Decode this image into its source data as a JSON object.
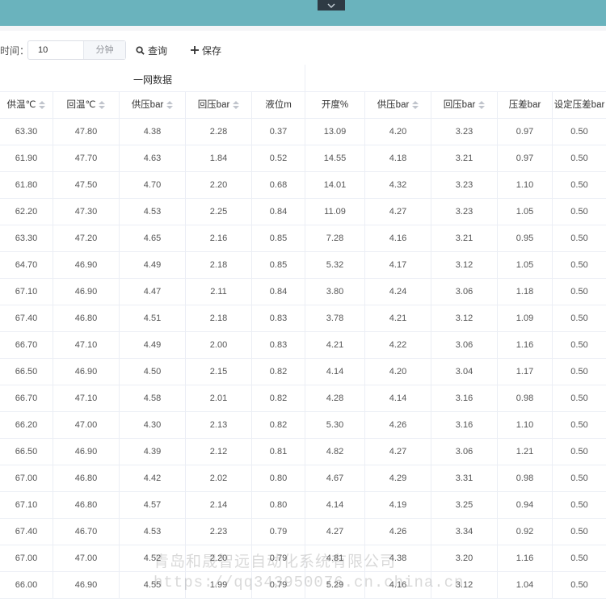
{
  "toolbar": {
    "time_label": "时间：",
    "interval_value": "10",
    "interval_unit": "分钟",
    "query_label": "查询",
    "save_label": "保存"
  },
  "group_title": "一网数据",
  "columns": [
    "供温℃",
    "回温℃",
    "供压bar",
    "回压bar",
    "液位m",
    "开度%",
    "供压bar",
    "回压bar",
    "压差bar",
    "设定压差bar"
  ],
  "rows": [
    [
      "63.30",
      "47.80",
      "4.38",
      "2.28",
      "0.37",
      "13.09",
      "4.20",
      "3.23",
      "0.97",
      "0.50"
    ],
    [
      "61.90",
      "47.70",
      "4.63",
      "1.84",
      "0.52",
      "14.55",
      "4.18",
      "3.21",
      "0.97",
      "0.50"
    ],
    [
      "61.80",
      "47.50",
      "4.70",
      "2.20",
      "0.68",
      "14.01",
      "4.32",
      "3.23",
      "1.10",
      "0.50"
    ],
    [
      "62.20",
      "47.30",
      "4.53",
      "2.25",
      "0.84",
      "11.09",
      "4.27",
      "3.23",
      "1.05",
      "0.50"
    ],
    [
      "63.30",
      "47.20",
      "4.65",
      "2.16",
      "0.85",
      "7.28",
      "4.16",
      "3.21",
      "0.95",
      "0.50"
    ],
    [
      "64.70",
      "46.90",
      "4.49",
      "2.18",
      "0.85",
      "5.32",
      "4.17",
      "3.12",
      "1.05",
      "0.50"
    ],
    [
      "67.10",
      "46.90",
      "4.47",
      "2.11",
      "0.84",
      "3.80",
      "4.24",
      "3.06",
      "1.18",
      "0.50"
    ],
    [
      "67.40",
      "46.80",
      "4.51",
      "2.18",
      "0.83",
      "3.78",
      "4.21",
      "3.12",
      "1.09",
      "0.50"
    ],
    [
      "66.70",
      "47.10",
      "4.49",
      "2.00",
      "0.83",
      "4.21",
      "4.22",
      "3.06",
      "1.16",
      "0.50"
    ],
    [
      "66.50",
      "46.90",
      "4.50",
      "2.15",
      "0.82",
      "4.14",
      "4.20",
      "3.04",
      "1.17",
      "0.50"
    ],
    [
      "66.70",
      "47.10",
      "4.58",
      "2.01",
      "0.82",
      "4.28",
      "4.14",
      "3.16",
      "0.98",
      "0.50"
    ],
    [
      "66.20",
      "47.00",
      "4.30",
      "2.13",
      "0.82",
      "5.30",
      "4.26",
      "3.16",
      "1.10",
      "0.50"
    ],
    [
      "66.50",
      "46.90",
      "4.39",
      "2.12",
      "0.81",
      "4.82",
      "4.27",
      "3.06",
      "1.21",
      "0.50"
    ],
    [
      "67.00",
      "46.80",
      "4.42",
      "2.02",
      "0.80",
      "4.67",
      "4.29",
      "3.31",
      "0.98",
      "0.50"
    ],
    [
      "67.10",
      "46.80",
      "4.57",
      "2.14",
      "0.80",
      "4.14",
      "4.19",
      "3.25",
      "0.94",
      "0.50"
    ],
    [
      "67.40",
      "46.70",
      "4.53",
      "2.23",
      "0.79",
      "4.27",
      "4.26",
      "3.34",
      "0.92",
      "0.50"
    ],
    [
      "67.00",
      "47.00",
      "4.52",
      "2.20",
      "0.79",
      "4.81",
      "4.38",
      "3.20",
      "1.16",
      "0.50"
    ],
    [
      "66.00",
      "46.90",
      "4.55",
      "1.99",
      "0.79",
      "5.29",
      "4.16",
      "3.12",
      "1.04",
      "0.50"
    ]
  ],
  "watermark": {
    "line1": "青岛和晟智远自动化系统有限公司",
    "line2": "https://qq343950076.cn.china.cn"
  }
}
